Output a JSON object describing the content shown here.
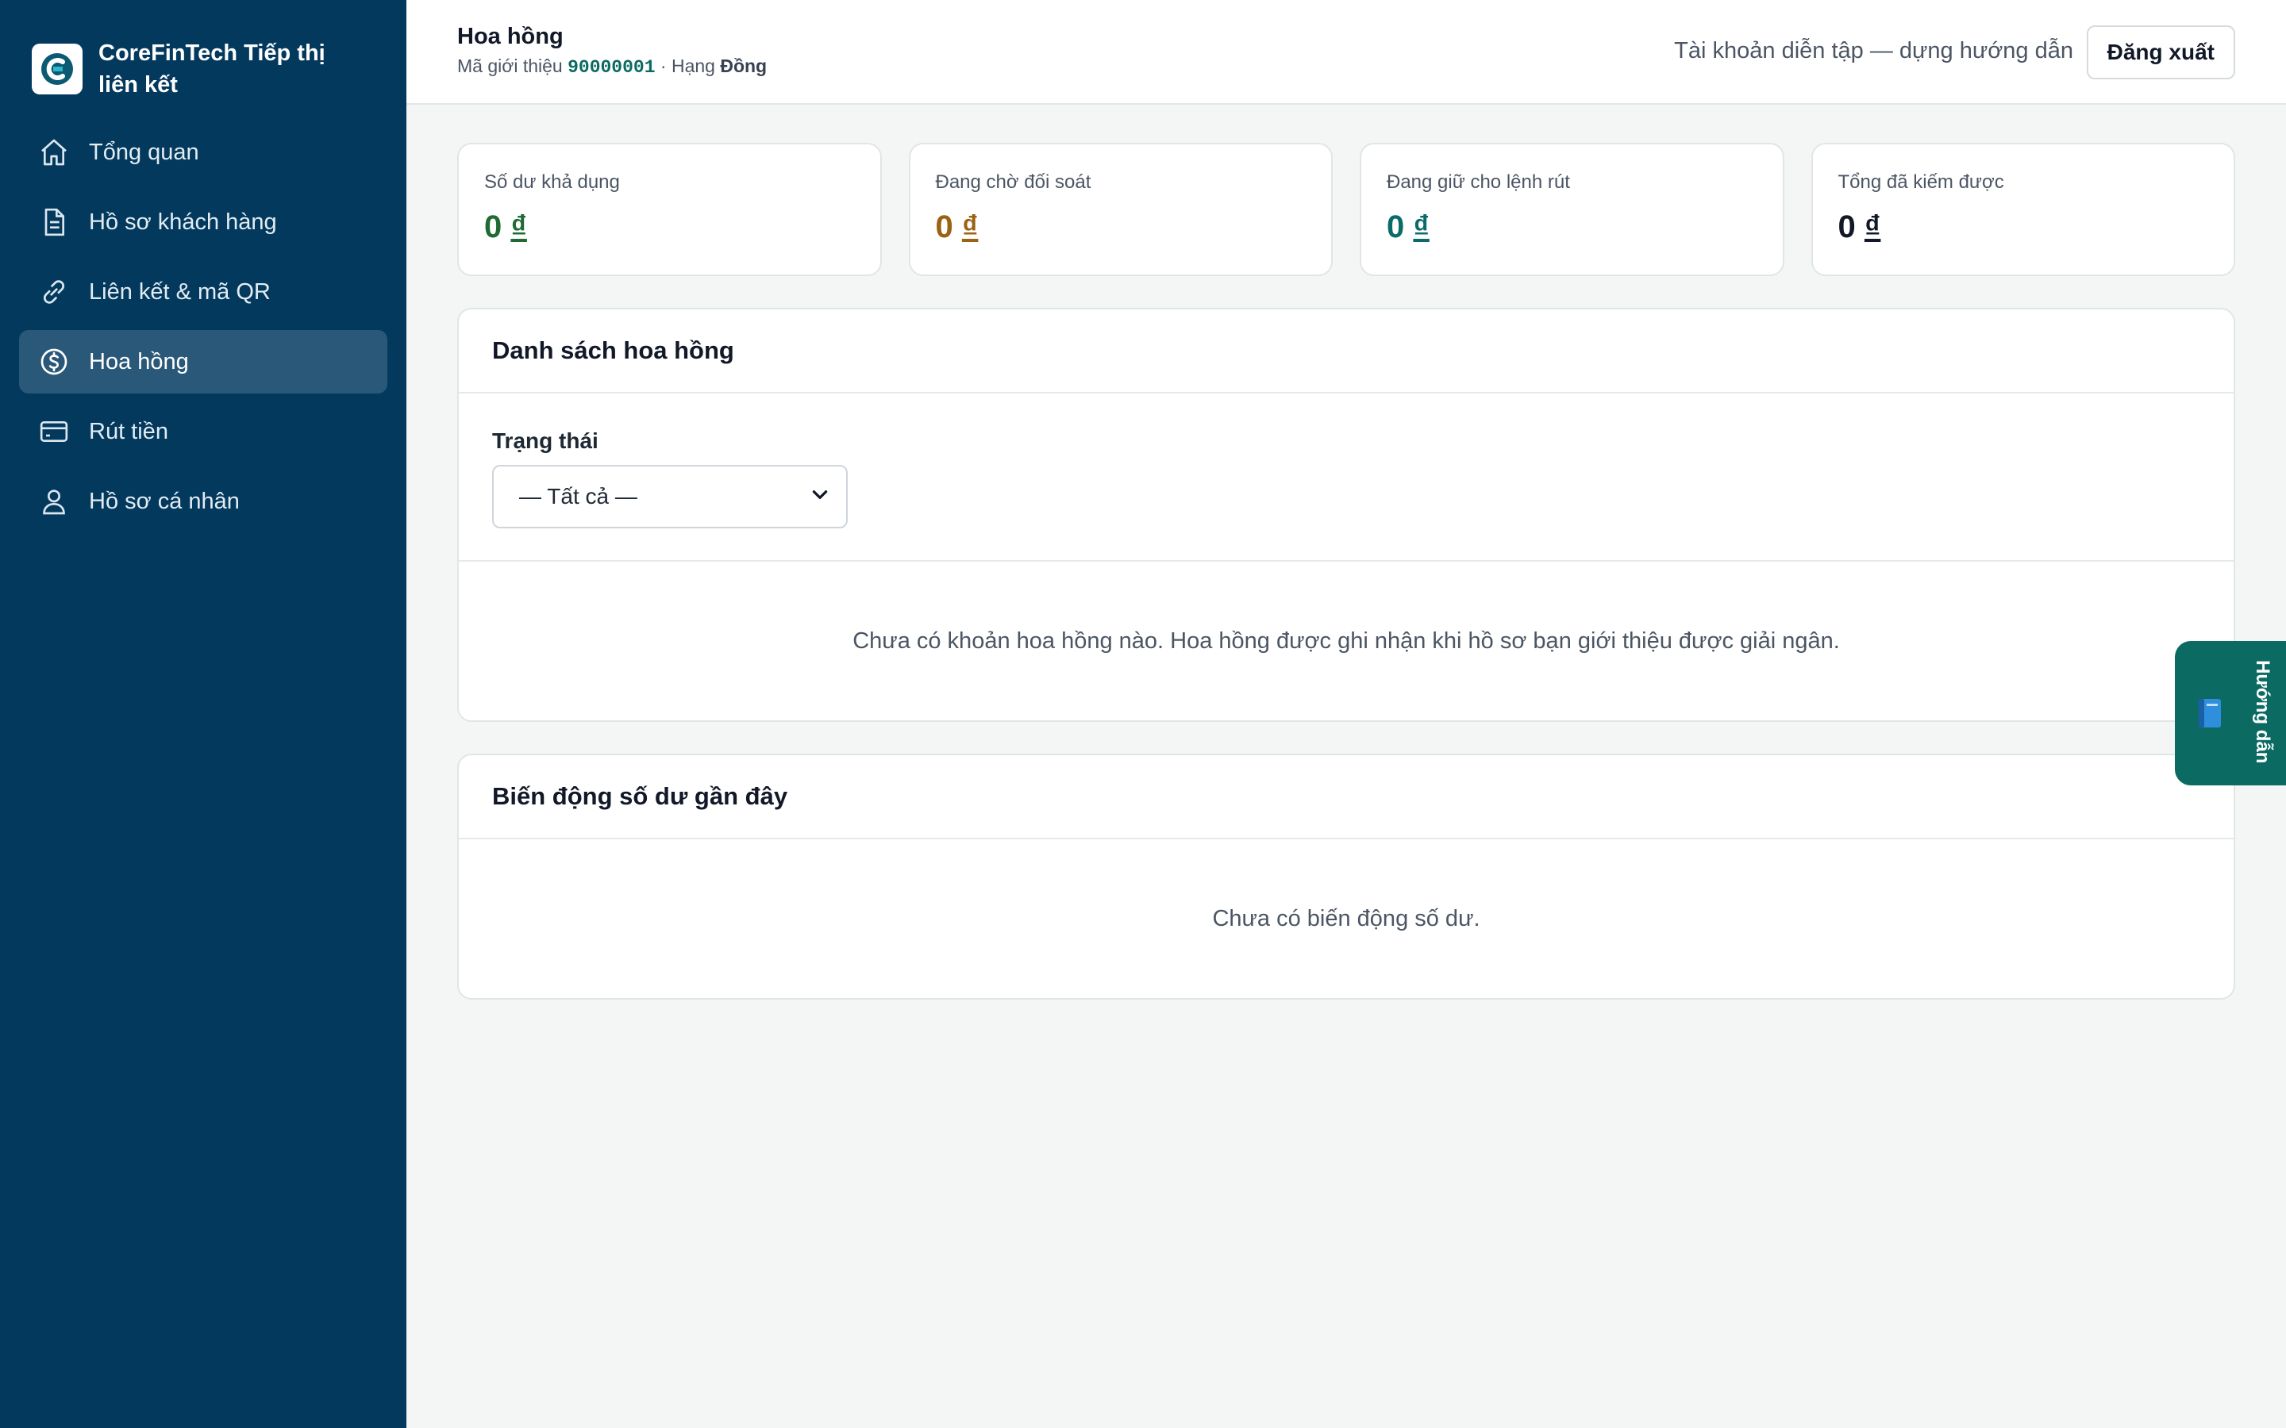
{
  "app": {
    "name": "CoreFinTech Tiếp thị liên kết"
  },
  "sidebar": {
    "items": [
      {
        "label": "Tổng quan",
        "icon": "home-icon"
      },
      {
        "label": "Hồ sơ khách hàng",
        "icon": "document-icon"
      },
      {
        "label": "Liên kết & mã QR",
        "icon": "link-icon"
      },
      {
        "label": "Hoa hồng",
        "icon": "dollar-circle-icon",
        "active": true
      },
      {
        "label": "Rút tiền",
        "icon": "credit-card-icon"
      },
      {
        "label": "Hồ sơ cá nhân",
        "icon": "user-icon"
      }
    ]
  },
  "header": {
    "title": "Hoa hồng",
    "ref_prefix": "Mã giới thiệu ",
    "ref_code": "90000001",
    "tier_prefix": " · Hạng ",
    "tier": "Đồng",
    "demo_note": "Tài khoản diễn tập — dựng hướng dẫn",
    "logout_label": "Đăng xuất"
  },
  "stats": [
    {
      "label": "Số dư khả dụng",
      "value": "0",
      "unit": "₫",
      "color": "#1f6b33"
    },
    {
      "label": "Đang chờ đối soát",
      "value": "0",
      "unit": "₫",
      "color": "#9a6212"
    },
    {
      "label": "Đang giữ cho lệnh rút",
      "value": "0",
      "unit": "₫",
      "color": "#0b6b6b"
    },
    {
      "label": "Tổng đã kiếm được",
      "value": "0",
      "unit": "₫",
      "color": "#111827"
    }
  ],
  "commissions": {
    "title": "Danh sách hoa hồng",
    "filter_label": "Trạng thái",
    "filter_value": "— Tất cả —",
    "empty": "Chưa có khoản hoa hồng nào. Hoa hồng được ghi nhận khi hồ sơ bạn giới thiệu được giải ngân."
  },
  "balance": {
    "title": "Biến động số dư gần đây",
    "empty": "Chưa có biến động số dư."
  },
  "guide": {
    "label": "Hướng dẫn",
    "icon": "book-icon"
  },
  "colors": {
    "sidebar": "#04395e",
    "accent": "#0b6b63",
    "active_item": "#2a5878"
  }
}
